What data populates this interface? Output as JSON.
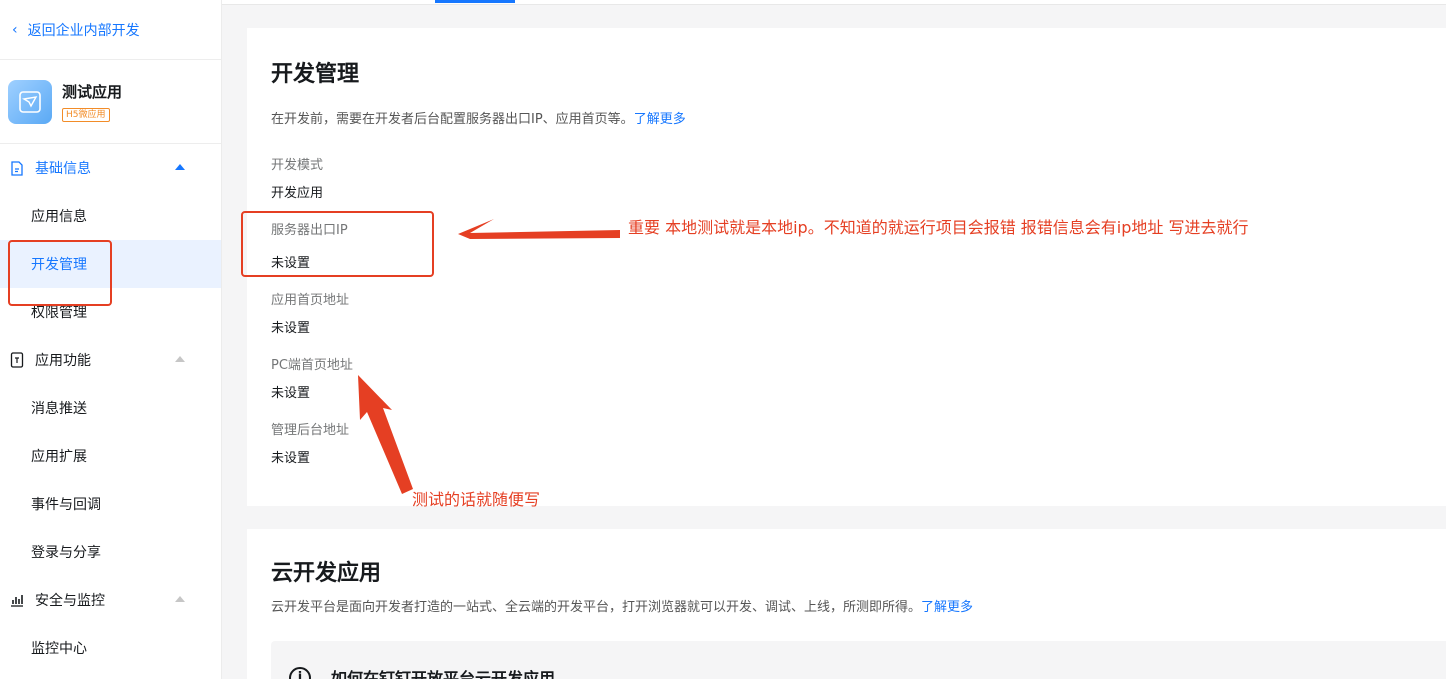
{
  "sidebar": {
    "back_label": "返回企业内部开发",
    "app": {
      "name": "测试应用",
      "tag": "H5微应用"
    },
    "groups": [
      {
        "label": "基础信息",
        "icon": "document-icon",
        "items": [
          "应用信息",
          "开发管理",
          "权限管理"
        ]
      },
      {
        "label": "应用功能",
        "icon": "app-function-icon",
        "items": [
          "消息推送",
          "应用扩展",
          "事件与回调",
          "登录与分享"
        ]
      },
      {
        "label": "安全与监控",
        "icon": "bar-chart-icon",
        "items": [
          "监控中心"
        ]
      }
    ]
  },
  "dev": {
    "title": "开发管理",
    "desc": "在开发前，需要在开发者后台配置服务器出口IP、应用首页等。",
    "learn_more": "了解更多",
    "fields": [
      {
        "key": "开发模式",
        "value": "开发应用"
      },
      {
        "key": "服务器出口IP",
        "value": "未设置"
      },
      {
        "key": "应用首页地址",
        "value": "未设置"
      },
      {
        "key": "PC端首页地址",
        "value": "未设置"
      },
      {
        "key": "管理后台地址",
        "value": "未设置"
      }
    ]
  },
  "cloud": {
    "title": "云开发应用",
    "desc": "云开发平台是面向开发者打造的一站式、全云端的开发平台，打开浏览器就可以开发、调试、上线，所测即所得。",
    "learn_more": "了解更多",
    "info_title": "如何在钉钉开放平台云开发应用"
  },
  "annotations": {
    "note_ip": "重要 本地测试就是本地ip。不知道的就运行项目会报错 报错信息会有ip地址 写进去就行",
    "note_test": "测试的话就随便写",
    "color": "#e53f23"
  }
}
